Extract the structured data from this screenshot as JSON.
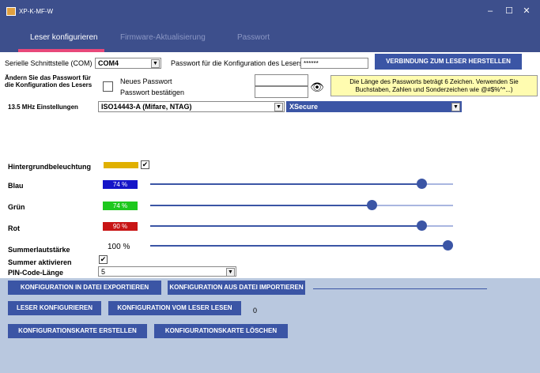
{
  "window": {
    "title": "XP-K-MF-W",
    "minimize_glyph": "–",
    "maximize_glyph": "☐",
    "close_glyph": "✕"
  },
  "tabs": [
    {
      "label": "Leser konfigurieren",
      "active": true
    },
    {
      "label": "Firmware-Aktualisierung",
      "active": false
    },
    {
      "label": "Passwort",
      "active": false
    }
  ],
  "connection": {
    "com_label": "Serielle Schnittstelle (COM)",
    "com_value": "COM4",
    "password_label": "Passwort für die Konfiguration des Lesers",
    "password_value": "******",
    "connect_button": "VERBINDUNG ZUM LESER HERSTELLEN"
  },
  "password_change": {
    "label": "Ändern Sie das Passwort für die Konfiguration des Lesers",
    "new_password_label": "Neues Passwort",
    "confirm_password_label": "Passwort bestätigen",
    "new_password_value": "",
    "confirm_password_value": "",
    "hint": "Die Länge des Passworts beträgt 6 Zeichen. Verwenden Sie Buchstaben, Zahlen und Sonderzeichen wie @#$%^*...)"
  },
  "mhz": {
    "label": "13.5 MHz Einstellungen",
    "protocol_value": "ISO14443-A (Mifare, NTAG)",
    "secure_value": "XSecure"
  },
  "lighting": {
    "backlight_label": "Hintergrundbeleuchtung",
    "backlight_checked": true,
    "backlight_color": "#e0b000",
    "blue_label": "Blau",
    "blue_value": "74 %",
    "blue_level": 0.91,
    "blue_color": "#1515c8",
    "green_label": "Grün",
    "green_value": "74 %",
    "green_level": 0.74,
    "green_color": "#1ec81e",
    "red_label": "Rot",
    "red_value": "90 %",
    "red_level": 0.91,
    "red_color": "#c81515",
    "buzzer_volume_label": "Summerlautstärke",
    "buzzer_volume_value": "100 %",
    "buzzer_level": 1.0
  },
  "buzzer": {
    "enable_label": "Summer aktivieren",
    "enabled": true
  },
  "pin": {
    "label": "PIN-Code-Länge",
    "value": "5"
  },
  "actions": {
    "export": "KONFIGURATION IN DATEI EXPORTIEREN",
    "import": "KONFIGURATION AUS DATEI IMPORTIEREN",
    "configure": "LESER KONFIGURIEREN",
    "read": "KONFIGURATION VOM LESER LESEN",
    "read_count": "0",
    "create_card": "KONFIGURATIONSKARTE ERSTELLEN",
    "delete_card": "KONFIGURATIONSKARTE LÖSCHEN"
  },
  "icons": {
    "eye": "👁",
    "check": "✔",
    "dropdown": "▼"
  }
}
